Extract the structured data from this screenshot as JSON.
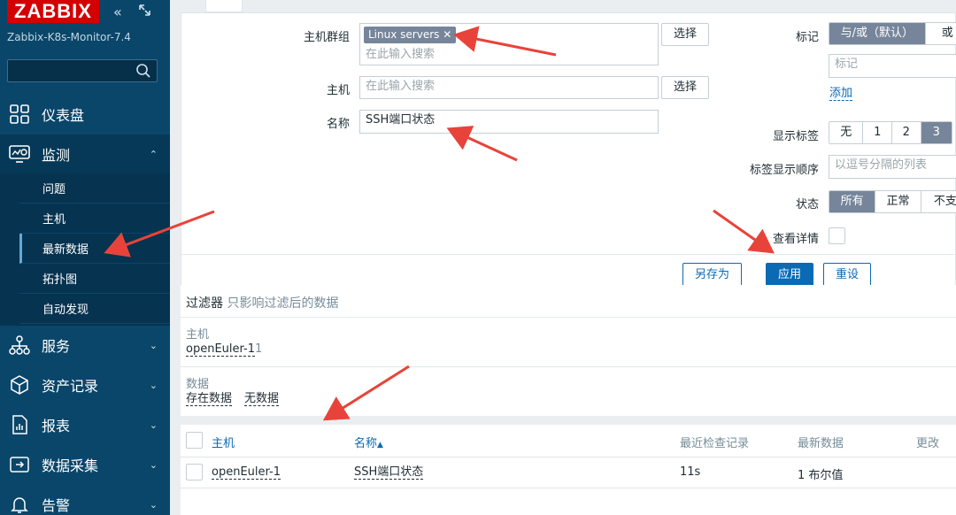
{
  "sidebar": {
    "logo": "ZABBIX",
    "instance": "Zabbix-K8s-Monitor-7.4",
    "search_placeholder": "",
    "items": [
      {
        "label": "仪表盘",
        "icon": "dashboard-icon"
      },
      {
        "label": "监测",
        "icon": "monitoring-icon"
      },
      {
        "label": "服务",
        "icon": "services-icon"
      },
      {
        "label": "资产记录",
        "icon": "inventory-icon"
      },
      {
        "label": "报表",
        "icon": "reports-icon"
      },
      {
        "label": "数据采集",
        "icon": "data-collection-icon"
      },
      {
        "label": "告警",
        "icon": "alerts-icon"
      }
    ],
    "submenu": [
      "问题",
      "主机",
      "最新数据",
      "拓扑图",
      "自动发现"
    ]
  },
  "filter": {
    "hostgroup_label": "主机群组",
    "hostgroup_chip": "Linux servers",
    "hostgroup_placeholder": "在此输入搜索",
    "host_label": "主机",
    "host_placeholder": "在此输入搜索",
    "name_label": "名称",
    "name_value": "SSH端口状态",
    "select_label": "选择",
    "tags_label": "标记",
    "tags_and_or": "与/或（默认）",
    "tags_or": "或",
    "tag_placeholder": "标记",
    "add_link": "添加",
    "show_tags_label": "显示标签",
    "show_tags_options": [
      "无",
      "1",
      "2",
      "3"
    ],
    "tag_order_label": "标签显示顺序",
    "tag_order_placeholder": "以逗号分隔的列表",
    "state_label": "状态",
    "state_options": [
      "所有",
      "正常",
      "不支"
    ],
    "details_label": "查看详情",
    "save_as": "另存为",
    "apply": "应用",
    "reset": "重设"
  },
  "summary": {
    "title": "过滤器",
    "subtitle": "只影响过滤后的数据",
    "host_label": "主机",
    "host_link": "openEuler-1",
    "host_count": "1",
    "data_label": "数据",
    "data_with": "存在数据",
    "data_without": "无数据"
  },
  "table": {
    "headers": {
      "host": "主机",
      "name": "名称",
      "name_sort": "▲",
      "last_check": "最近检查记录",
      "last_value": "最新数据",
      "change": "更改"
    },
    "rows": [
      {
        "host": "openEuler-1",
        "name": "SSH端口状态",
        "last_check": "11s",
        "last_value": "1 布尔值"
      }
    ]
  },
  "colors": {
    "sidebar": "#0a466a",
    "accent": "#0a6ab4",
    "arrow": "#e8433a",
    "logo": "#d40000"
  }
}
